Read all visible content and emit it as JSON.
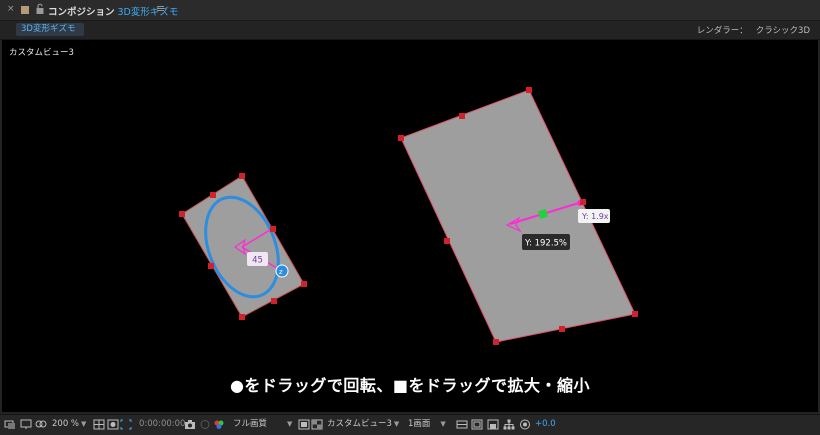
{
  "panel": {
    "close_glyph": "×",
    "title": "コンポジション",
    "comp_name": "3D変形ギズモ",
    "menu_glyph": "≡",
    "comp_chip": "3D変形ギズモ",
    "renderer_label": "レンダラー：",
    "renderer_value": "クラシック3D"
  },
  "viewer": {
    "view_name": "カスタムビュー3",
    "rotation_readout": "45",
    "scale_readout_small": "Y: 1.9x",
    "scale_readout_main": "Y: 192.5%",
    "axis_label": "z",
    "caption": "●をドラッグで回転、■をドラッグで拡大・縮小"
  },
  "bottombar": {
    "zoom": "200 %",
    "timecode": "0:00:00:00",
    "resolution": "フル画質",
    "view": "カスタムビュー3",
    "layout": "1画面",
    "exposure": "+0.0"
  },
  "colors": {
    "accent_blue": "#3fa9f5",
    "gizmo_magenta": "#ff2bd6",
    "handle_red": "#d0222a",
    "layer_gray": "#9e9e9e",
    "rotation_ring": "#2d8de0",
    "scale_green": "#22d13b"
  },
  "icons": [
    "close-icon",
    "lock-icon",
    "menu-icon",
    "camera-icon",
    "grid-icon",
    "mask-icon",
    "color-icon",
    "region-icon",
    "3d-view-icon",
    "flowchart-icon",
    "exposure-icon"
  ]
}
